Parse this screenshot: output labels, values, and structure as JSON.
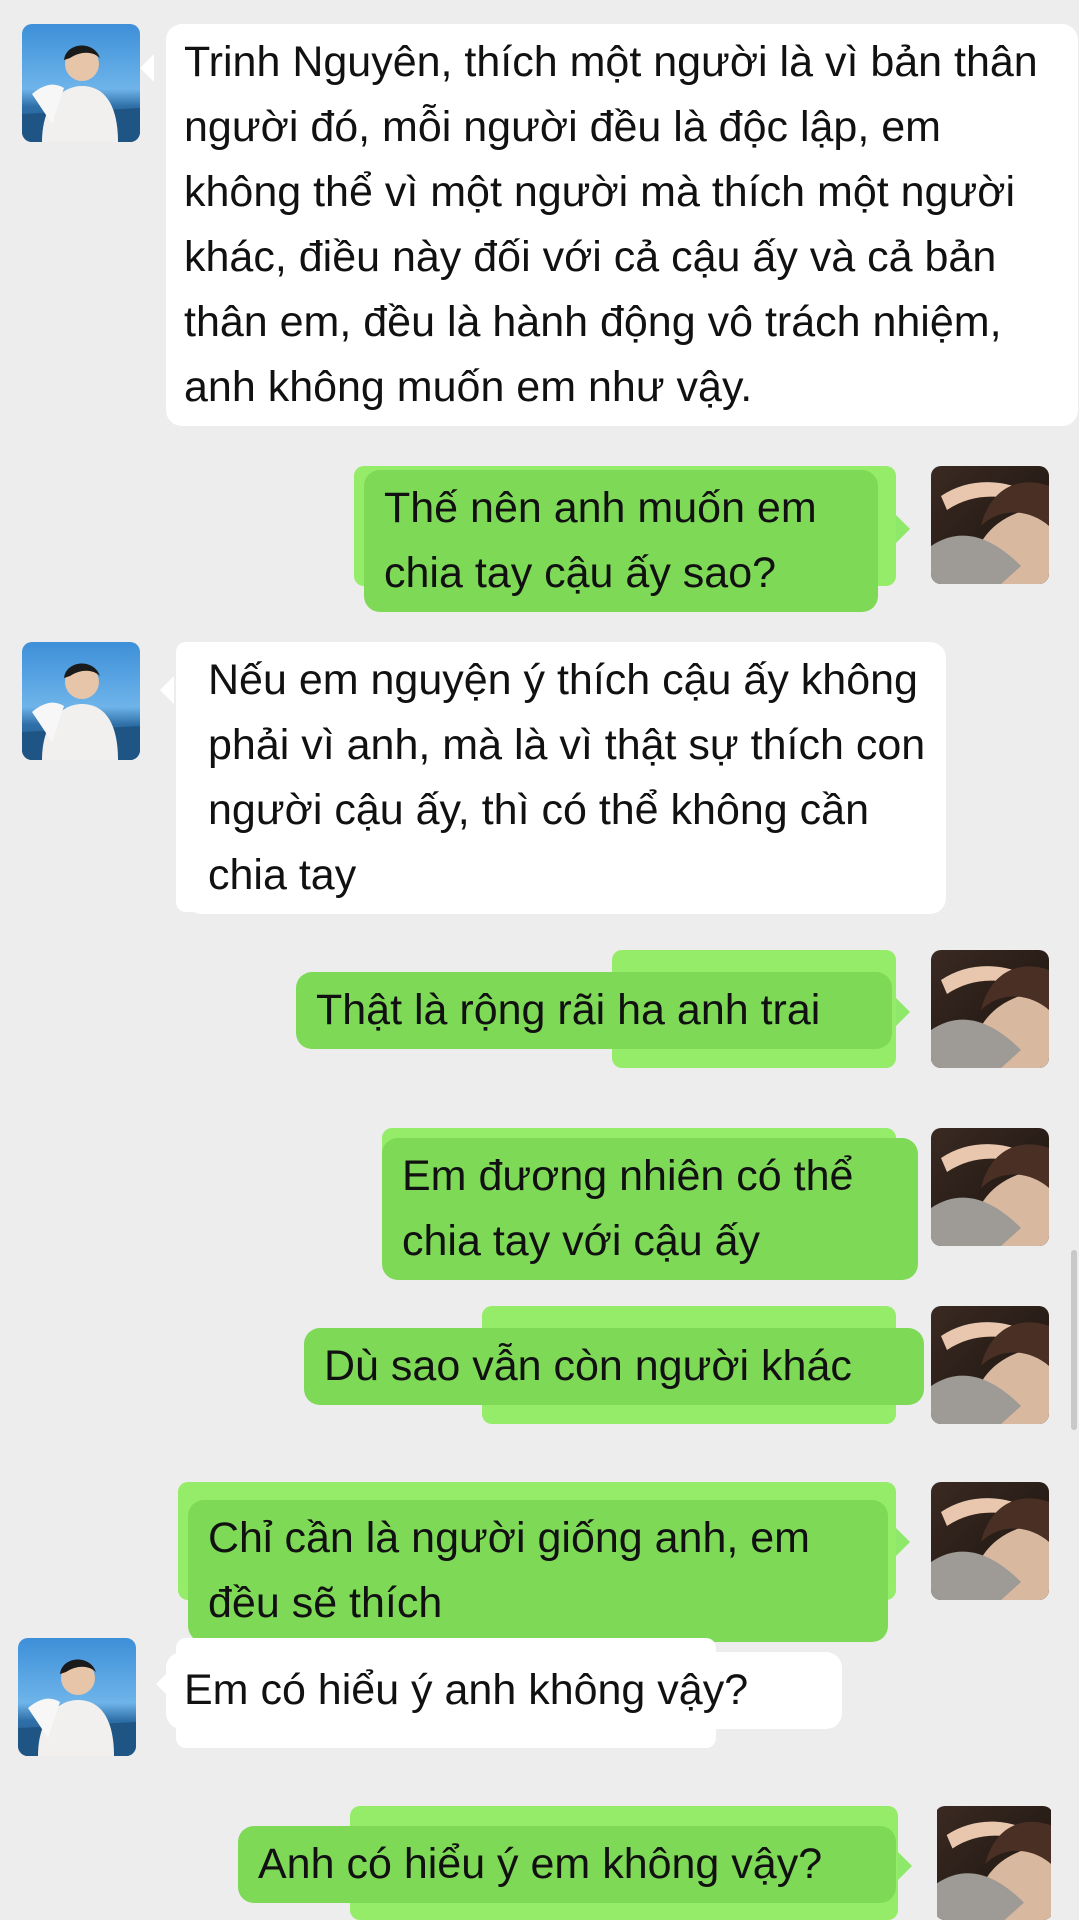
{
  "colors": {
    "background": "#ededed",
    "incoming_bubble": "#ffffff",
    "outgoing_bubble": "#7ed957",
    "outgoing_bubble_back": "#95ec69"
  },
  "messages": [
    {
      "side": "left",
      "text": "Trinh Nguyên, thích một người là vì bản thân người đó, mỗi người đều là độc lập, em không thể vì một người mà thích một người khác, điều này đối với cả cậu ấy và cả bản thân em, đều là hành động vô trách nhiệm, anh không muốn em như vậy."
    },
    {
      "side": "right",
      "text": "Thế nên anh muốn em chia tay cậu ấy sao?"
    },
    {
      "side": "left",
      "text": "Nếu em nguyện ý thích cậu ấy không phải vì anh, mà là vì thật sự thích con người cậu ấy, thì có thể không cần chia tay"
    },
    {
      "side": "right",
      "text": "Thật là rộng rãi ha anh trai"
    },
    {
      "side": "right",
      "text": "Em đương nhiên có thể chia tay với cậu ấy"
    },
    {
      "side": "right",
      "text": "Dù sao vẫn còn người khác"
    },
    {
      "side": "right",
      "text": "Chỉ cần là người giống anh, em đều sẽ thích"
    },
    {
      "side": "left",
      "text": "Em có hiểu ý anh không vậy?"
    },
    {
      "side": "right",
      "text": "Anh có hiểu ý em không vậy?"
    }
  ],
  "avatars": {
    "left_icon": "contact-avatar-photo",
    "right_icon": "self-avatar-photo"
  }
}
